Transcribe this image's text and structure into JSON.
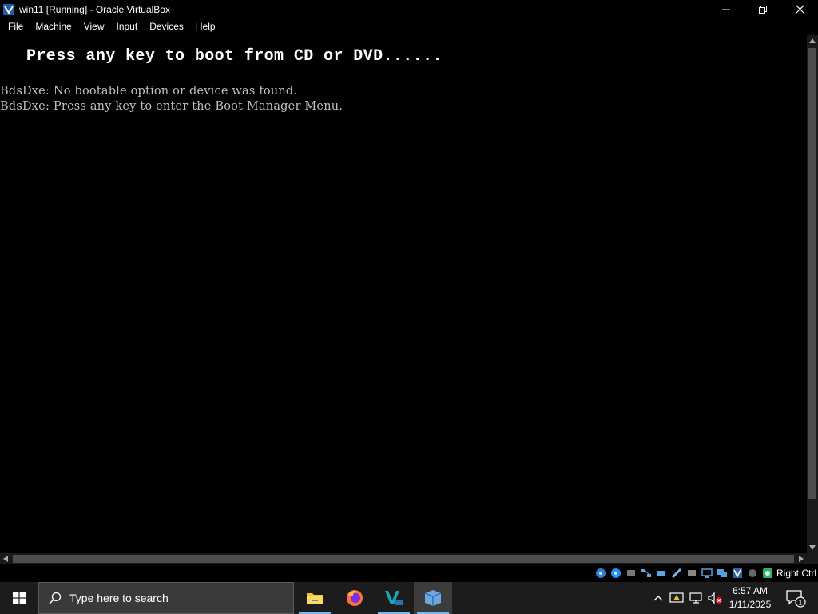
{
  "window": {
    "title": "win11 [Running] - Oracle VirtualBox"
  },
  "menu": {
    "items": [
      "File",
      "Machine",
      "View",
      "Input",
      "Devices",
      "Help"
    ]
  },
  "vm_screen": {
    "boot_message": "Press any key to boot from CD or DVD......",
    "uefi_lines": [
      "BdsDxe: No bootable option or device was found.",
      "BdsDxe: Press any key to enter the Boot Manager Menu."
    ]
  },
  "statusbar": {
    "icons": [
      "hard-disk-icon",
      "optical-drive-icon",
      "audio-icon",
      "network-icon",
      "usb-icon",
      "shared-folders-icon",
      "display-icon",
      "video-capture-icon",
      "recording-icon",
      "virtualization-icon",
      "mouse-integration-icon",
      "host-key-icon"
    ],
    "host_key": "Right Ctrl"
  },
  "taskbar": {
    "search_placeholder": "Type here to search",
    "time": "6:57 AM",
    "date": "1/11/2025",
    "notification_count": "1"
  }
}
